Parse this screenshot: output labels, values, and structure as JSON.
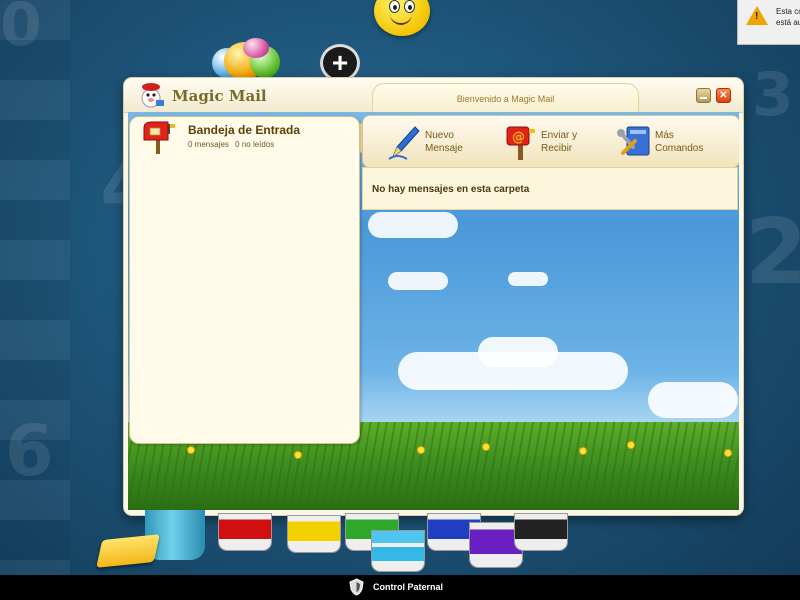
{
  "window": {
    "app_title": "Magic Mail",
    "tab_title": "Bienvenido a Magic Mail"
  },
  "folder": {
    "name": "Bandeja de Entrada",
    "messages": "0 mensajes",
    "unread": "0 no leídos"
  },
  "toolbar": {
    "new_message_line1": "Nuevo",
    "new_message_line2": "Mensaje",
    "send_receive_line1": "Enviar y",
    "send_receive_line2": "Recibir",
    "more_line1": "Más",
    "more_line2": "Comandos"
  },
  "status_text": "No hay mensajes en esta carpeta",
  "notification": {
    "line1": "Esta co",
    "line2": "está au"
  },
  "taskbar": {
    "label": "Control Paternal"
  },
  "colors": {
    "accent": "#7a5a16",
    "close": "#d8420c",
    "warning": "#f0a500"
  }
}
